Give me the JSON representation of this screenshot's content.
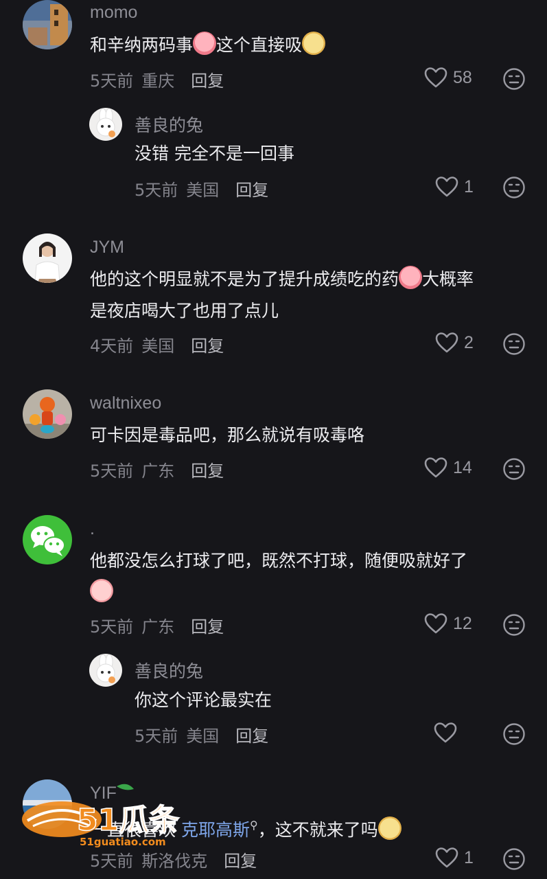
{
  "comments": [
    {
      "user": "momo",
      "text_parts": [
        "和辛纳两码事",
        "这个直接吸"
      ],
      "time": "5天前",
      "location": "重庆",
      "reply": "回复",
      "likes": "58"
    },
    {
      "user": "善良的兔",
      "text": "没错 完全不是一回事",
      "time": "5天前",
      "location": "美国",
      "reply": "回复",
      "likes": "1"
    },
    {
      "user": "JYM",
      "text_parts": [
        "他的这个明显就不是为了提升成绩吃的药",
        "大概率",
        "是夜店喝大了也用了点儿"
      ],
      "time": "4天前",
      "location": "美国",
      "reply": "回复",
      "likes": "2"
    },
    {
      "user": "waltnixeo",
      "text": "可卡因是毒品吧，那么就说有吸毒咯",
      "time": "5天前",
      "location": "广东",
      "reply": "回复",
      "likes": "14"
    },
    {
      "user": ".",
      "text": "他都没怎么打球了吧，既然不打球，随便吸就好了",
      "time": "5天前",
      "location": "广东",
      "reply": "回复",
      "likes": "12"
    },
    {
      "user": "善良的兔",
      "text": "你这个评论最实在",
      "time": "5天前",
      "location": "美国",
      "reply": "回复",
      "likes": ""
    },
    {
      "user": "YIF",
      "text_parts": [
        "一直很喜欢",
        "克耶高斯",
        "，这不就来了吗"
      ],
      "time": "5天前",
      "location": "斯洛伐克",
      "reply": "回复",
      "likes": "1"
    }
  ],
  "watermark": {
    "brand": "51瓜条",
    "url": "51guatiao.com"
  },
  "colors": {
    "background": "#16161a",
    "link": "#7ea6ea",
    "text": "#ececef",
    "muted": "#84848c"
  }
}
